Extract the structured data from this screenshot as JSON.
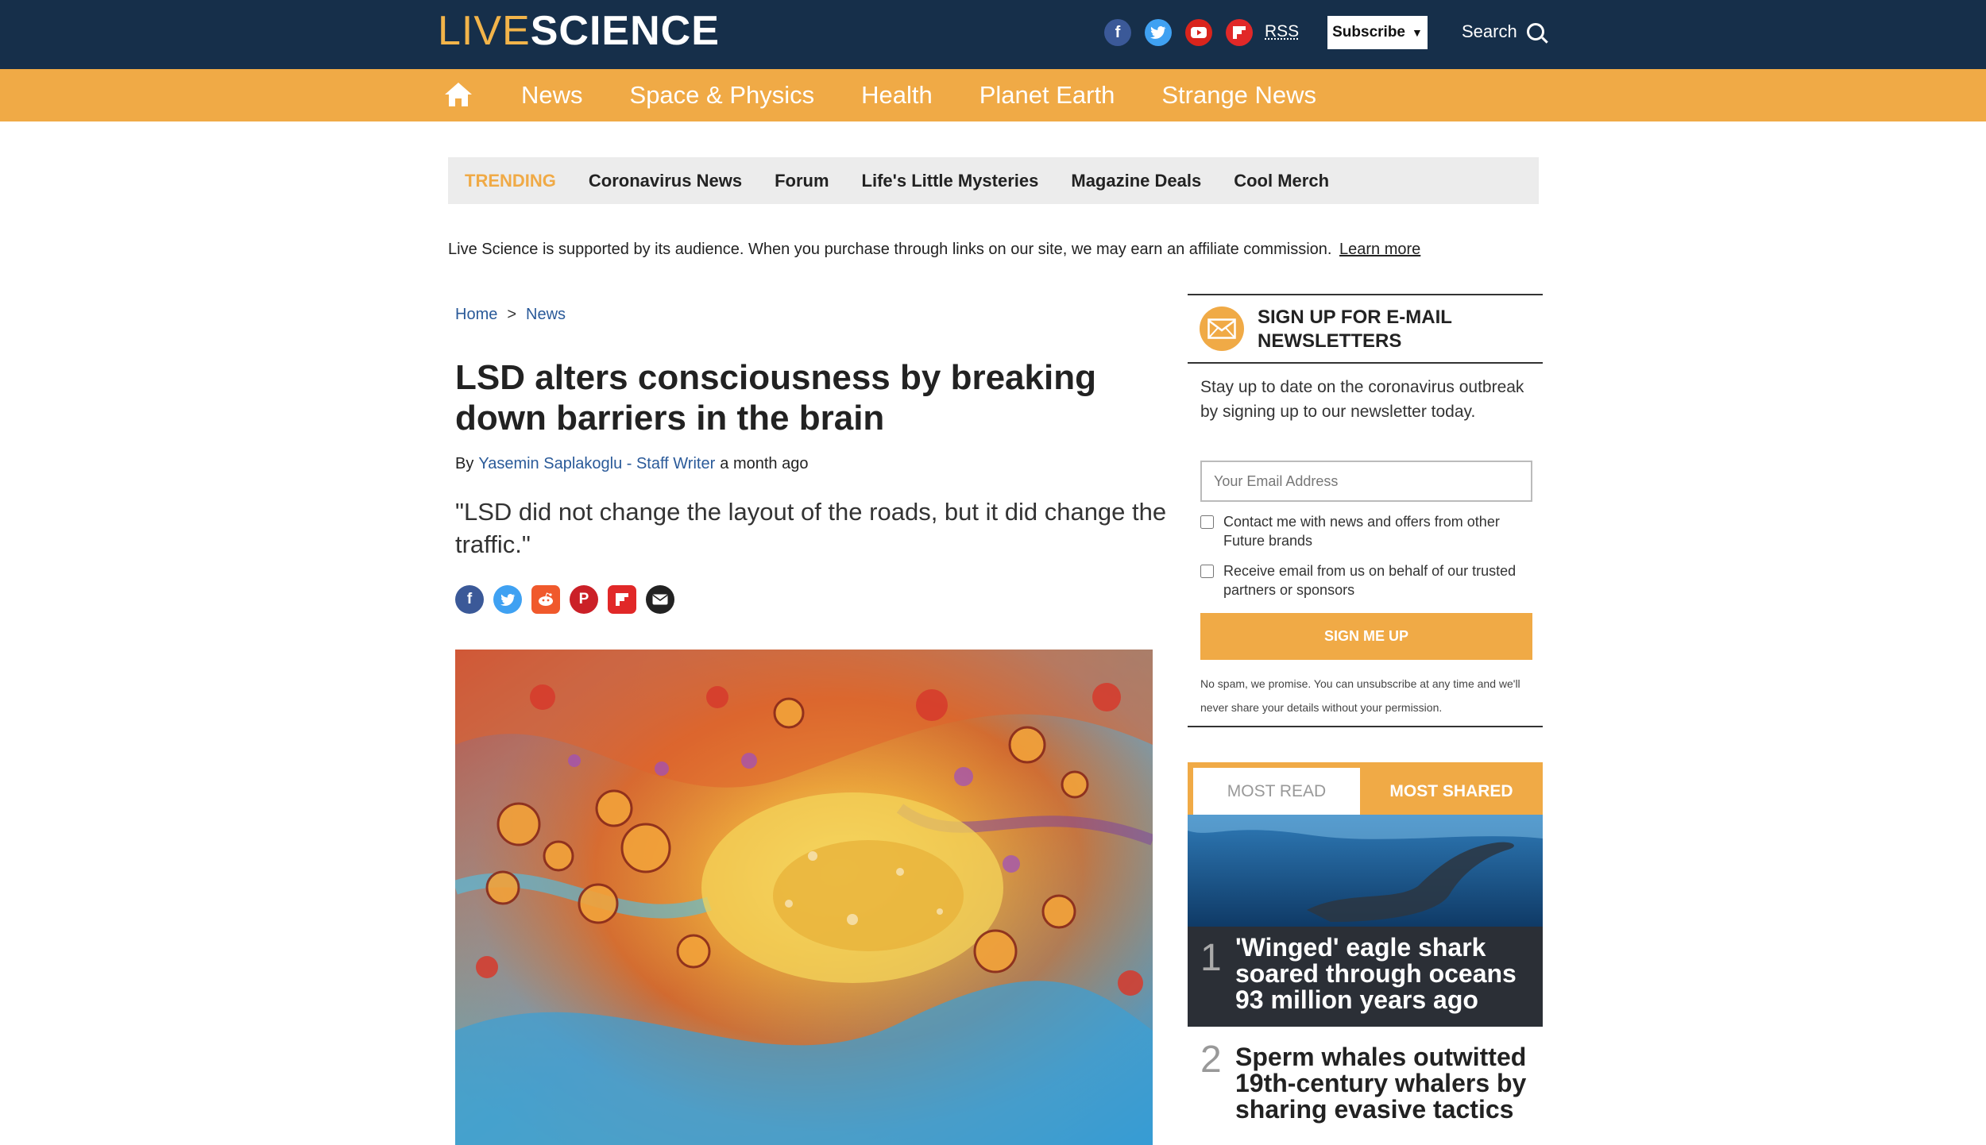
{
  "header": {
    "logo_part1": "LIVE",
    "logo_part2": "SCIENCE",
    "social_icons": [
      "facebook-icon",
      "twitter-icon",
      "youtube-icon",
      "flipboard-icon"
    ],
    "rss_label": "RSS",
    "subscribe_label": "Subscribe",
    "search_label": "Search"
  },
  "nav": {
    "items": [
      "News",
      "Space & Physics",
      "Health",
      "Planet Earth",
      "Strange News"
    ]
  },
  "trending": {
    "label": "TRENDING",
    "items": [
      "Coronavirus News",
      "Forum",
      "Life's Little Mysteries",
      "Magazine Deals",
      "Cool Merch"
    ]
  },
  "affiliate": {
    "text": "Live Science is supported by its audience. When you purchase through links on our site, we may earn an affiliate commission.",
    "link": "Learn more"
  },
  "article": {
    "breadcrumb": [
      "Home",
      ">",
      "News"
    ],
    "title": "LSD alters consciousness by breaking down barriers in the brain",
    "by": "By",
    "author": "Yasemin Saplakoglu - Staff Writer",
    "time": "a month ago",
    "dek": "\"LSD did not change the layout of the roads, but it did change the traffic.\"",
    "share_icons": [
      "facebook-icon",
      "twitter-icon",
      "reddit-icon",
      "pinterest-icon",
      "flipboard-icon",
      "email-icon"
    ]
  },
  "newsletter": {
    "title": "SIGN UP FOR E-MAIL NEWSLETTERS",
    "text": "Stay up to date on the coronavirus outbreak by signing up to our newsletter today.",
    "email_placeholder": "Your Email Address",
    "checkbox1": "Contact me with news and offers from other Future brands",
    "checkbox2": "Receive email from us on behalf of our trusted partners or sponsors",
    "button": "SIGN ME UP",
    "disclaimer": "No spam, we promise. You can unsubscribe at any time and we'll never share your details without your permission."
  },
  "most_read": {
    "tab_read": "MOST READ",
    "tab_shared": "MOST SHARED",
    "items": [
      {
        "rank": "1",
        "title": "'Winged' eagle shark soared through oceans 93 million years ago"
      },
      {
        "rank": "2",
        "title": "Sperm whales outwitted 19th-century whalers by sharing evasive tactics"
      }
    ]
  },
  "colors": {
    "header_bg": "#162f4a",
    "accent_orange": "#f0aa46",
    "link_blue": "#2a5a99"
  }
}
